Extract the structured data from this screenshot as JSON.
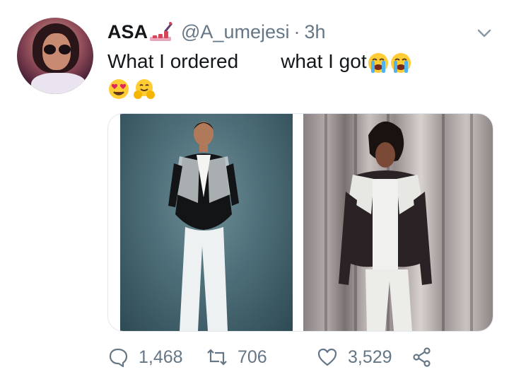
{
  "tweet": {
    "author_name": "ASA",
    "handle": "@A_umejesi",
    "separator": "·",
    "time": "3h",
    "text_left": "What I ordered",
    "text_right": "what I got",
    "name_emoji": "💅",
    "text_emojis": [
      "😭",
      "😭"
    ],
    "line2_emojis": [
      "😍",
      "🤗"
    ]
  },
  "media": {
    "left_photo": "woman-in-embellished-blazer-photo",
    "right_photo": "person-in-blazer-photo"
  },
  "actions": {
    "reply_count": "1,468",
    "retweet_count": "706",
    "like_count": "3,529"
  },
  "colors": {
    "text": "#14171a",
    "secondary": "#657786",
    "border": "#e1e8ed"
  }
}
